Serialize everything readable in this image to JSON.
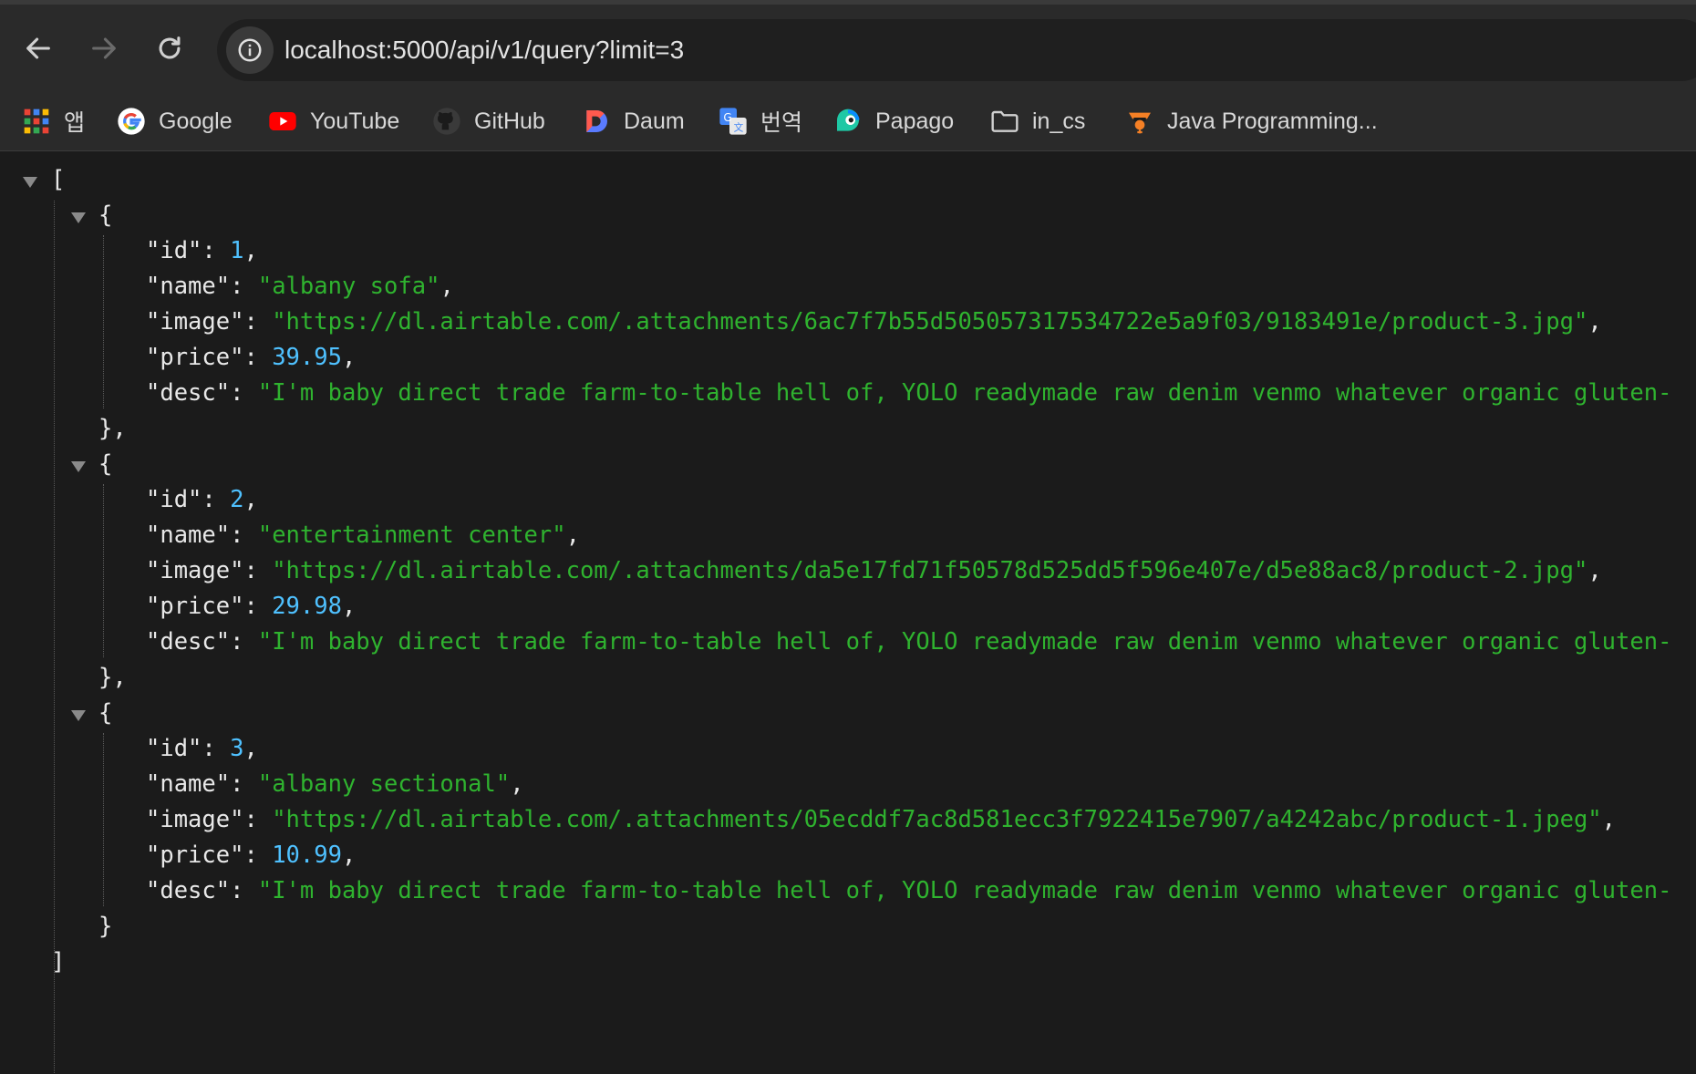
{
  "toolbar": {
    "url": "localhost:5000/api/v1/query?limit=3"
  },
  "bookmarks": [
    {
      "label": "앱",
      "icon": "apps-grid-icon"
    },
    {
      "label": "Google",
      "icon": "google-icon"
    },
    {
      "label": "YouTube",
      "icon": "youtube-icon"
    },
    {
      "label": "GitHub",
      "icon": "github-icon"
    },
    {
      "label": "Daum",
      "icon": "daum-icon"
    },
    {
      "label": "번역",
      "icon": "translate-icon"
    },
    {
      "label": "Papago",
      "icon": "papago-icon"
    },
    {
      "label": "in_cs",
      "icon": "folder-icon"
    },
    {
      "label": "Java Programming...",
      "icon": "java-icon"
    }
  ],
  "json": {
    "open_bracket": "[",
    "close_bracket": "]",
    "open_brace": "{",
    "close_brace_comma": "},",
    "close_brace": "}",
    "items": [
      {
        "id": "1",
        "name": "\"albany sofa\"",
        "image": "\"https://dl.airtable.com/.attachments/6ac7f7b55d505057317534722e5a9f03/9183491e/product-3.jpg\"",
        "price": "39.95",
        "desc": "\"I'm baby direct trade farm-to-table hell of, YOLO readymade raw denim venmo whatever organic gluten-"
      },
      {
        "id": "2",
        "name": "\"entertainment center\"",
        "image": "\"https://dl.airtable.com/.attachments/da5e17fd71f50578d525dd5f596e407e/d5e88ac8/product-2.jpg\"",
        "price": "29.98",
        "desc": "\"I'm baby direct trade farm-to-table hell of, YOLO readymade raw denim venmo whatever organic gluten-"
      },
      {
        "id": "3",
        "name": "\"albany sectional\"",
        "image": "\"https://dl.airtable.com/.attachments/05ecddf7ac8d581ecc3f7922415e7907/a4242abc/product-1.jpeg\"",
        "price": "10.99",
        "desc": "\"I'm baby direct trade farm-to-table hell of, YOLO readymade raw denim venmo whatever organic gluten-"
      }
    ],
    "keys": {
      "id": "\"id\"",
      "name": "\"name\"",
      "image": "\"image\"",
      "price": "\"price\"",
      "desc": "\"desc\""
    }
  }
}
